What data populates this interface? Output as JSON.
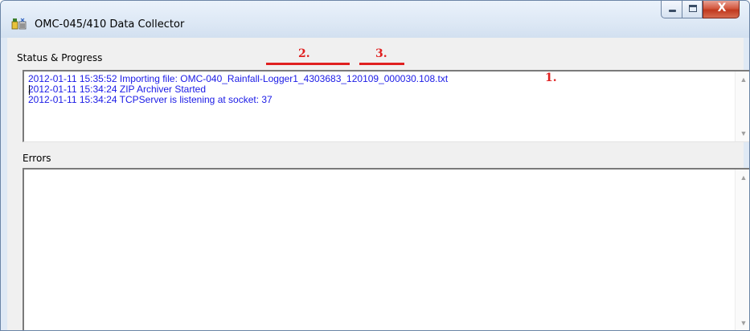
{
  "window": {
    "title": "OMC-045/410 Data Collector",
    "controls": {
      "minimize": "minimize-icon",
      "maximize": "maximize-icon",
      "close_label": "X"
    }
  },
  "status": {
    "label": "Status & Progress",
    "lines": [
      "2012-01-11 15:35:52 Importing file: OMC-040_Rainfall-Logger1_4303683_120109_000030.108.txt",
      "2012-01-11 15:34:24 ZIP Archiver Started",
      "2012-01-11 15:34:24 TCPServer is listening at socket: 37"
    ]
  },
  "errors": {
    "label": "Errors",
    "lines": []
  },
  "annotations": [
    "1.",
    "2.",
    "3."
  ],
  "colors": {
    "log_text": "#1a1ae6",
    "annotation": "#e02020",
    "close_button": "#c0391e"
  },
  "scroll_icons": {
    "up": "▲",
    "down": "▼"
  }
}
